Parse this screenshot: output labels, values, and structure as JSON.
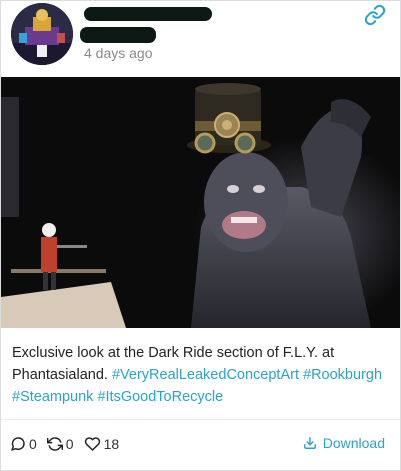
{
  "post": {
    "timestamp": "4 days ago",
    "text": {
      "main": "Exclusive look at the Dark Ride section of F.L.Y. at Phantasialand.",
      "hashtags": [
        "#VeryRealLeakedConceptArt",
        "#Rookburgh",
        "#Steampunk",
        "#ItsGoodToRecycle"
      ]
    }
  },
  "actions": {
    "replies": "0",
    "reposts": "0",
    "likes": "18",
    "download_label": "Download"
  },
  "colors": {
    "accent": "#2aa3c8",
    "muted_text": "#8a8a8a",
    "redaction": "#0d1a14"
  },
  "icons": [
    "link-icon",
    "reply-icon",
    "repost-icon",
    "heart-icon",
    "download-icon"
  ]
}
